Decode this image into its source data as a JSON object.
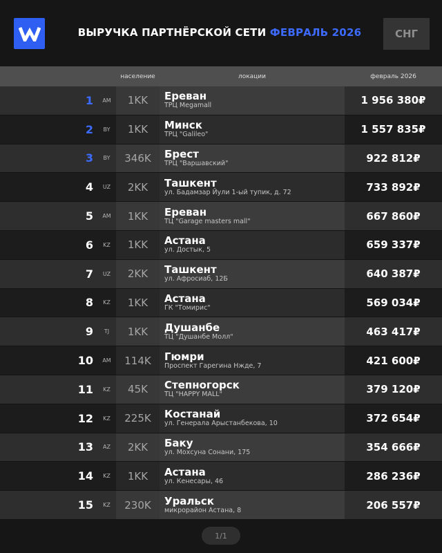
{
  "header": {
    "logo_letter": "W",
    "title_main": "ВЫРУЧКА ПАРТНЁРСКОЙ СЕТИ",
    "title_accent": "ФЕВРАЛЬ 2026",
    "region_label": "СНГ"
  },
  "columns": {
    "population": "население",
    "locations": "локации",
    "revenue": "февраль 2026"
  },
  "rows": [
    {
      "rank": "1",
      "country": "AM",
      "population": "1KK",
      "city": "Ереван",
      "place": "ТРЦ Megamall",
      "revenue": "1 956 380₽",
      "highlight": true
    },
    {
      "rank": "2",
      "country": "BY",
      "population": "1KK",
      "city": "Минск",
      "place": "ТРЦ \"Galileo\"",
      "revenue": "1 557 835₽",
      "highlight": true
    },
    {
      "rank": "3",
      "country": "BY",
      "population": "346K",
      "city": "Брест",
      "place": "ТРЦ \"Варшавский\"",
      "revenue": "922 812₽",
      "highlight": true
    },
    {
      "rank": "4",
      "country": "UZ",
      "population": "2KK",
      "city": "Ташкент",
      "place": "ул. Бадамзар Йули 1-ый тупик, д. 72",
      "revenue": "733 892₽",
      "highlight": false
    },
    {
      "rank": "5",
      "country": "AM",
      "population": "1KK",
      "city": "Ереван",
      "place": "ТЦ \"Garage masters mall\"",
      "revenue": "667 860₽",
      "highlight": false
    },
    {
      "rank": "6",
      "country": "KZ",
      "population": "1KK",
      "city": "Астана",
      "place": "ул. Достык, 5",
      "revenue": "659 337₽",
      "highlight": false
    },
    {
      "rank": "7",
      "country": "UZ",
      "population": "2KK",
      "city": "Ташкент",
      "place": "ул. Афросиаб, 12Б",
      "revenue": "640 387₽",
      "highlight": false
    },
    {
      "rank": "8",
      "country": "KZ",
      "population": "1KK",
      "city": "Астана",
      "place": "ГК \"Томирис\"",
      "revenue": "569 034₽",
      "highlight": false
    },
    {
      "rank": "9",
      "country": "TJ",
      "population": "1KK",
      "city": "Душанбе",
      "place": "ТЦ \"Душанбе Молл\"",
      "revenue": "463 417₽",
      "highlight": false
    },
    {
      "rank": "10",
      "country": "AM",
      "population": "114K",
      "city": "Гюмри",
      "place": "Проспект Гарегина Нжде, 7",
      "revenue": "421 600₽",
      "highlight": false
    },
    {
      "rank": "11",
      "country": "KZ",
      "population": "45K",
      "city": "Степногорск",
      "place": "ТЦ \"HAPPY MALL\"",
      "revenue": "379 120₽",
      "highlight": false
    },
    {
      "rank": "12",
      "country": "KZ",
      "population": "225K",
      "city": "Костанай",
      "place": "ул. Генерала Арыстанбекова, 10",
      "revenue": "372 654₽",
      "highlight": false
    },
    {
      "rank": "13",
      "country": "AZ",
      "population": "2KK",
      "city": "Баку",
      "place": "ул. Мохсуна Сонани, 175",
      "revenue": "354 666₽",
      "highlight": false
    },
    {
      "rank": "14",
      "country": "KZ",
      "population": "1KK",
      "city": "Астана",
      "place": "ул. Кенесары, 46",
      "revenue": "286 236₽",
      "highlight": false
    },
    {
      "rank": "15",
      "country": "KZ",
      "population": "230K",
      "city": "Уральск",
      "place": "микрорайон Астана, 8",
      "revenue": "206 557₽",
      "highlight": false
    }
  ],
  "pager": {
    "label": "1/1"
  },
  "colors": {
    "accent": "#3d6bff",
    "logo_bg": "#2f5ff2"
  }
}
